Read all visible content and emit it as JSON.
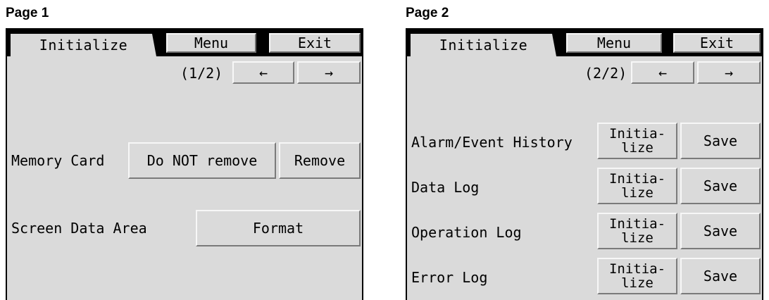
{
  "page1": {
    "label": "Page 1",
    "tab": "Initialize",
    "menu": "Menu",
    "exit": "Exit",
    "pager": "(1/2)",
    "prev": "←",
    "next": "→",
    "memory_card_label": "Memory Card",
    "do_not_remove": "Do NOT remove",
    "remove": "Remove",
    "screen_data_label": "Screen Data Area",
    "format": "Format"
  },
  "page2": {
    "label": "Page 2",
    "tab": "Initialize",
    "menu": "Menu",
    "exit": "Exit",
    "pager": "(2/2)",
    "prev": "←",
    "next": "→",
    "rows": [
      {
        "label": "Alarm/Event History",
        "init_line1": "Initia-",
        "init_line2": "lize",
        "save": "Save"
      },
      {
        "label": "Data Log",
        "init_line1": "Initia-",
        "init_line2": "lize",
        "save": "Save"
      },
      {
        "label": "Operation Log",
        "init_line1": "Initia-",
        "init_line2": "lize",
        "save": "Save"
      },
      {
        "label": "Error Log",
        "init_line1": "Initia-",
        "init_line2": "lize",
        "save": "Save"
      }
    ]
  }
}
